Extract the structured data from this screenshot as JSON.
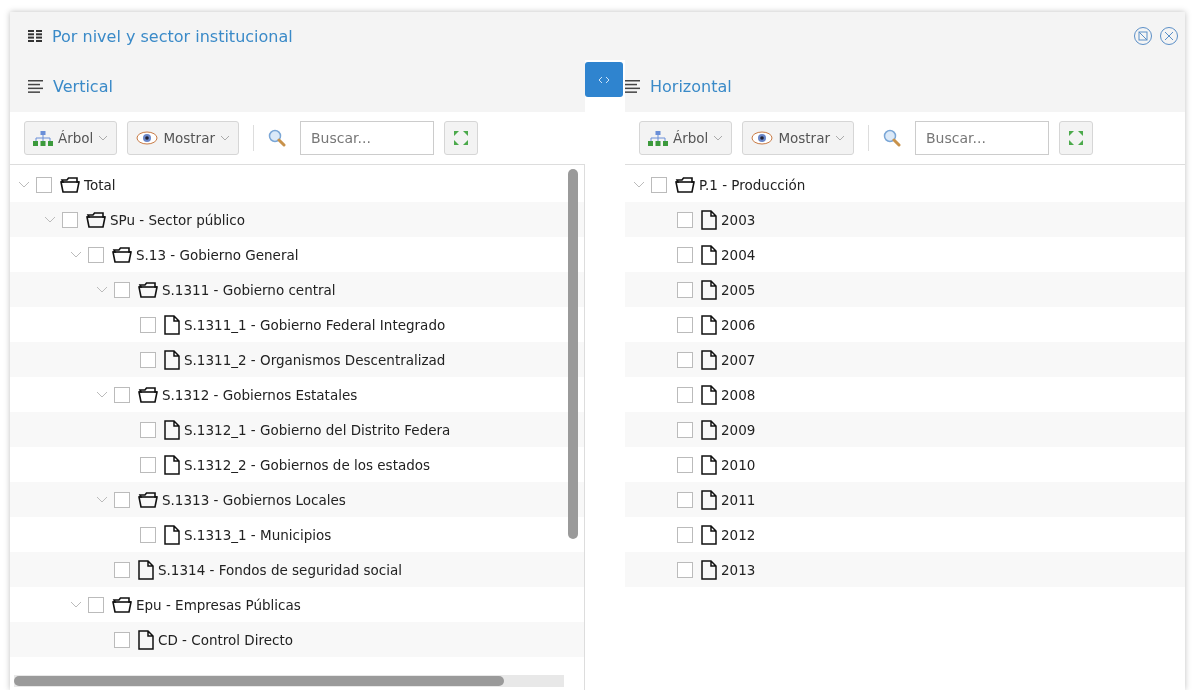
{
  "window": {
    "title": "Por nivel y sector institucional"
  },
  "panes": [
    {
      "title": "Vertical",
      "toolbar": {
        "tree_button": "Árbol",
        "show_button": "Mostrar",
        "search": {
          "placeholder": "Buscar..."
        }
      },
      "tree": [
        {
          "label": "Total",
          "kind": "folder",
          "expanded": true,
          "checked": false,
          "children": [
            {
              "label": "SPu - Sector público",
              "kind": "folder",
              "expanded": true,
              "checked": false,
              "children": [
                {
                  "label": "S.13 - Gobierno General",
                  "kind": "folder",
                  "expanded": true,
                  "checked": false,
                  "children": [
                    {
                      "label": "S.1311 - Gobierno central",
                      "kind": "folder",
                      "expanded": true,
                      "checked": false,
                      "children": [
                        {
                          "label": "S.1311_1 - Gobierno Federal Integrado",
                          "kind": "file",
                          "checked": false
                        },
                        {
                          "label": "S.1311_2 - Organismos Descentralizad",
                          "kind": "file",
                          "checked": false
                        }
                      ]
                    },
                    {
                      "label": "S.1312 - Gobiernos Estatales",
                      "kind": "folder",
                      "expanded": true,
                      "checked": false,
                      "children": [
                        {
                          "label": "S.1312_1 - Gobierno del Distrito Federa",
                          "kind": "file",
                          "checked": false
                        },
                        {
                          "label": "S.1312_2 - Gobiernos de los estados",
                          "kind": "file",
                          "checked": false
                        }
                      ]
                    },
                    {
                      "label": "S.1313 - Gobiernos Locales",
                      "kind": "folder",
                      "expanded": true,
                      "checked": false,
                      "children": [
                        {
                          "label": "S.1313_1 - Municipios",
                          "kind": "file",
                          "checked": false
                        }
                      ]
                    },
                    {
                      "label": "S.1314 - Fondos de seguridad social",
                      "kind": "file",
                      "checked": false
                    }
                  ]
                },
                {
                  "label": "Epu - Empresas Públicas",
                  "kind": "folder",
                  "expanded": true,
                  "checked": false,
                  "children": [
                    {
                      "label": "CD - Control Directo",
                      "kind": "file",
                      "checked": false
                    }
                  ]
                }
              ]
            }
          ]
        }
      ]
    },
    {
      "title": "Horizontal",
      "toolbar": {
        "tree_button": "Árbol",
        "show_button": "Mostrar",
        "search": {
          "placeholder": "Buscar..."
        }
      },
      "tree": [
        {
          "label": "P.1 - Producción",
          "kind": "folder",
          "expanded": true,
          "checked": false,
          "children": [
            {
              "label": "2003",
              "kind": "file",
              "checked": false
            },
            {
              "label": "2004",
              "kind": "file",
              "checked": false
            },
            {
              "label": "2005",
              "kind": "file",
              "checked": false
            },
            {
              "label": "2006",
              "kind": "file",
              "checked": false
            },
            {
              "label": "2007",
              "kind": "file",
              "checked": false
            },
            {
              "label": "2008",
              "kind": "file",
              "checked": false
            },
            {
              "label": "2009",
              "kind": "file",
              "checked": false
            },
            {
              "label": "2010",
              "kind": "file",
              "checked": false
            },
            {
              "label": "2011",
              "kind": "file",
              "checked": false
            },
            {
              "label": "2012",
              "kind": "file",
              "checked": false
            },
            {
              "label": "2013",
              "kind": "file",
              "checked": false
            }
          ]
        }
      ]
    }
  ]
}
